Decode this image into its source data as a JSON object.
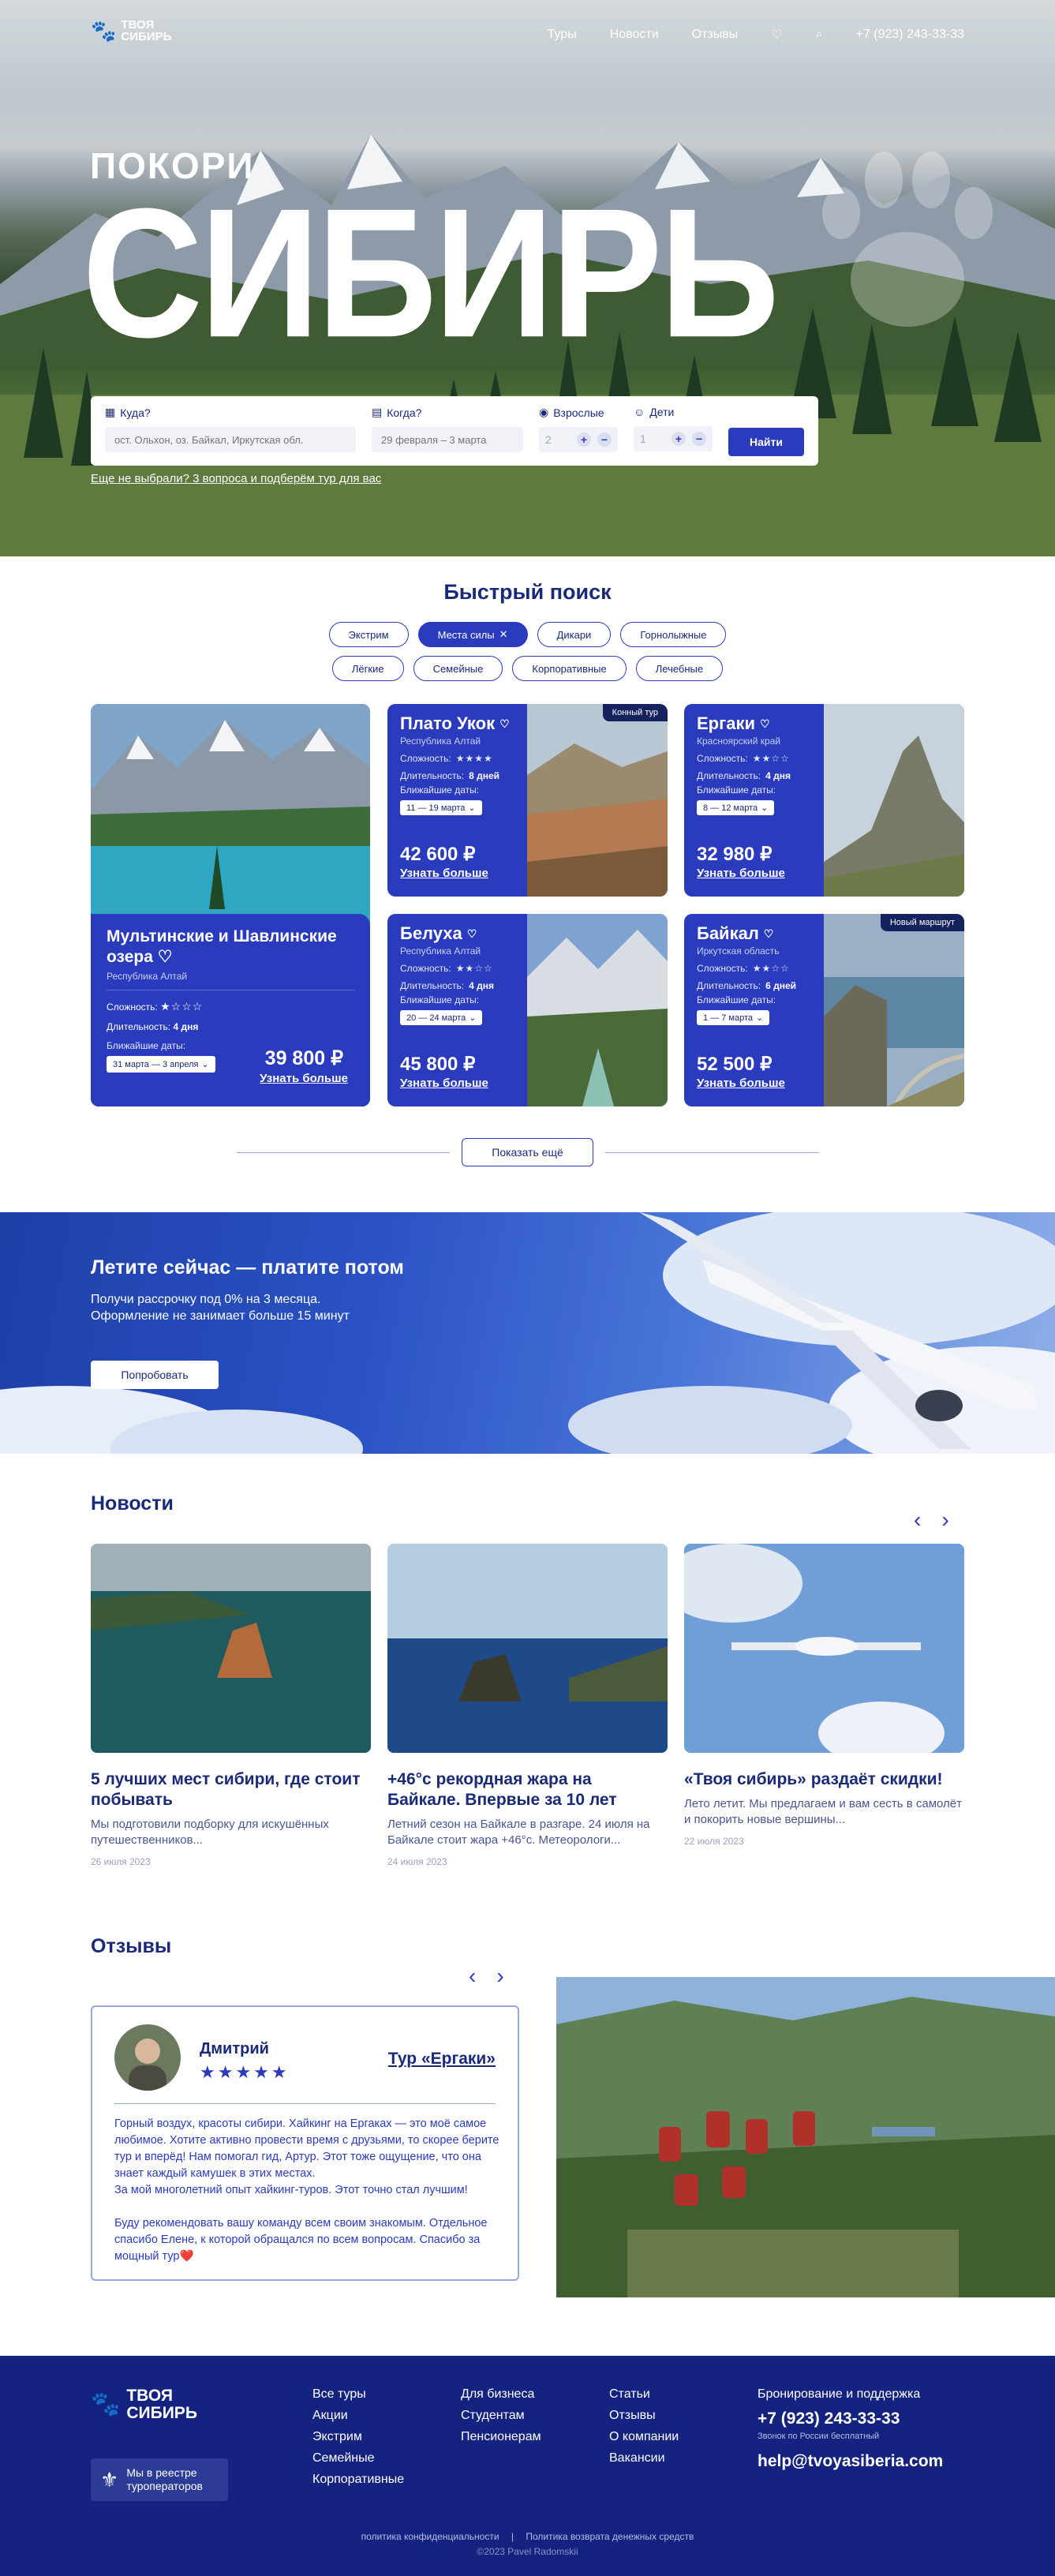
{
  "header": {
    "logo_line1": "ТВОЯ",
    "logo_line2": "СИБИРЬ",
    "nav": [
      "Туры",
      "Новости",
      "Отзывы"
    ],
    "phone": "+7 (923) 243-33-33"
  },
  "hero": {
    "title_small": "ПОКОРИ",
    "title_big": "СИБИРЬ",
    "search": {
      "where_label": "Куда?",
      "where_placeholder": "ост. Ольхон, оз. Байкал, Иркутская обл.",
      "when_label": "Когда?",
      "when_placeholder": "29 февраля – 3 марта",
      "adults_label": "Взрослые",
      "adults_value": "2",
      "kids_label": "Дети",
      "kids_value": "1",
      "find_label": "Найти"
    },
    "hint": "Еще не выбрали? 3 вопроса и подберём тур для вас"
  },
  "quick_search": {
    "title": "Быстрый поиск",
    "chips_row1": [
      {
        "label": "Экстрим",
        "active": false
      },
      {
        "label": "Места силы",
        "active": true
      },
      {
        "label": "Дикари",
        "active": false
      },
      {
        "label": "Горнолыжные",
        "active": false
      }
    ],
    "chips_row2": [
      {
        "label": "Лёгкие",
        "active": false
      },
      {
        "label": "Семейные",
        "active": false
      },
      {
        "label": "Корпоративные",
        "active": false
      },
      {
        "label": "Лечебные",
        "active": false
      }
    ]
  },
  "tour_labels": {
    "difficulty": "Сложность:",
    "duration": "Длительность:",
    "nearest": "Ближайшие даты:",
    "more": "Узнать больше"
  },
  "featured": {
    "name": "Мультинские и Шавлинские озера",
    "region": "Республика Алтай",
    "stars": "★☆☆☆",
    "duration": "4 дня",
    "dates": "31 марта — 3 апреля",
    "price": "39 800 ₽"
  },
  "tours": [
    {
      "name": "Плато Укок",
      "region": "Республика Алтай",
      "stars": "★★★★",
      "duration": "8 дней",
      "dates": "11 — 19 марта",
      "price": "42 600 ₽",
      "badge": "Конный тур"
    },
    {
      "name": "Ергаки",
      "region": "Красноярский край",
      "stars": "★★☆☆",
      "duration": "4 дня",
      "dates": "8 — 12 марта",
      "price": "32 980 ₽",
      "badge": ""
    },
    {
      "name": "Белуха",
      "region": "Республика Алтай",
      "stars": "★★☆☆",
      "duration": "4 дня",
      "dates": "20 — 24 марта",
      "price": "45 800 ₽",
      "badge": ""
    },
    {
      "name": "Байкал",
      "region": "Иркутская область",
      "stars": "★★☆☆",
      "duration": "6 дней",
      "dates": "1 — 7 марта",
      "price": "52 500 ₽",
      "badge": "Новый маршрут"
    }
  ],
  "show_more": "Показать ещё",
  "promo": {
    "title": "Летите сейчас — платите потом",
    "line1": "Получи рассрочку под 0% на 3 месяца.",
    "line2": "Оформление не занимает больше 15 минут",
    "button": "Попробовать"
  },
  "news": {
    "title": "Новости",
    "items": [
      {
        "title": "5 лучших мест сибири, где стоит побывать",
        "text": "Мы подготовили подборку для искушённых путешественников...",
        "date": "26 июля 2023"
      },
      {
        "title": "+46°с рекордная жара на Байкале. Впервые за 10 лет",
        "text": "Летний сезон на Байкале в разгаре. 24 июля на Байкале стоит жара +46°с. Метеорологи...",
        "date": "24 июля 2023"
      },
      {
        "title": "«Твоя сибирь» раздаёт скидки!",
        "text": "Лето летит. Мы предлагаем и вам сесть в самолёт и покорить новые вершины...",
        "date": "22 июля 2023"
      }
    ]
  },
  "reviews": {
    "title": "Отзывы",
    "name": "Дмитрий",
    "stars": "★★★★★",
    "tour": "Тур «Ергаки»",
    "text": "Горный воздух, красоты сибири. Хайкинг на Ергаках — это моё самое любимое. Хотите активно провести время с друзьями, то скорее берите тур и вперёд! Нам помогал гид, Артур. Этот тоже ощущение, что она знает каждый камушек в этих местах.\nЗа мой многолетний опыт хайкинг-туров. Этот точно стал лучшим!\n\nБуду рекомендовать вашу команду всем своим знакомым. Отдельное спасибо Елене, к которой обращался по всем вопросам. Спасибо за мощный тур❤️"
  },
  "footer": {
    "logo_line1": "ТВОЯ",
    "logo_line2": "СИБИРЬ",
    "reestr_line1": "Мы в реестре",
    "reestr_line2": "туроператоров",
    "col1": [
      "Все туры",
      "Акции",
      "Экстрим",
      "Семейные",
      "Корпоративные"
    ],
    "col2": [
      "Для бизнеса",
      "Студентам",
      "Пенсионерам"
    ],
    "col3": [
      "Статьи",
      "Отзывы",
      "О компании",
      "Вакансии"
    ],
    "support_title": "Бронирование и поддержка",
    "phone": "+7 (923) 243-33-33",
    "phone_note": "Звонок по России бесплатный",
    "email": "help@tvoyasiberia.com",
    "privacy": "политика конфиденциальности",
    "refund": "Политика возврата денежных средств",
    "copyright": "©2023 Pavel Radomskii"
  },
  "colors": {
    "brand": "#2a3bbd",
    "dark": "#14237f",
    "text": "#1a2a7a"
  }
}
